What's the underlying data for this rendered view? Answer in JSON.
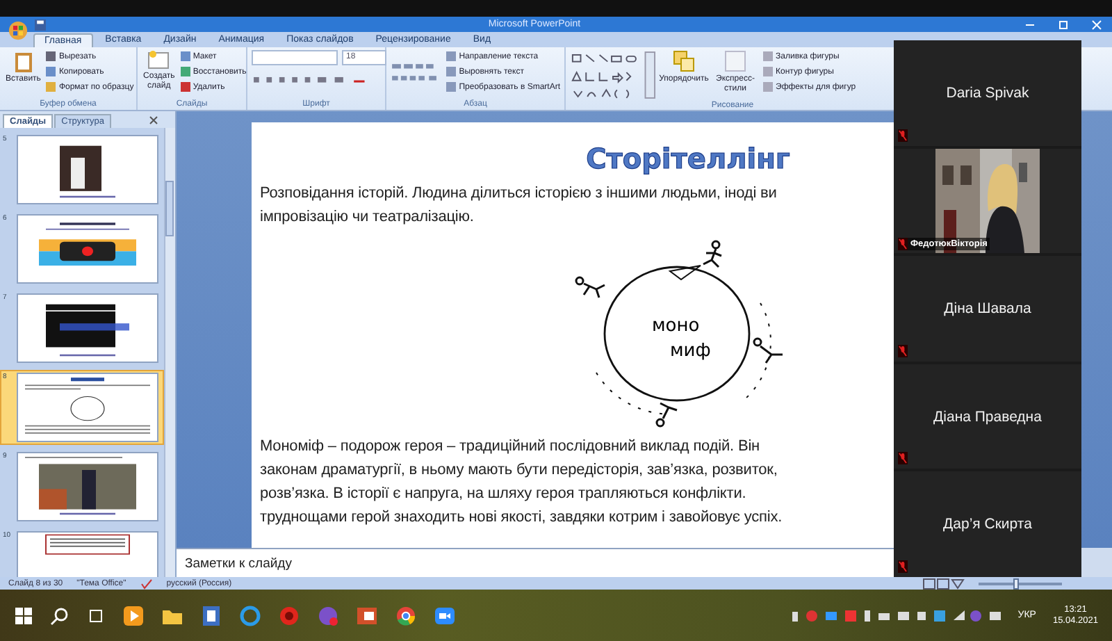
{
  "window": {
    "title": "Microsoft PowerPoint"
  },
  "ribbon_tabs": [
    {
      "label": "Главная",
      "selected": true
    },
    {
      "label": "Вставка",
      "selected": false
    },
    {
      "label": "Дизайн",
      "selected": false
    },
    {
      "label": "Анимация",
      "selected": false
    },
    {
      "label": "Показ слайдов",
      "selected": false
    },
    {
      "label": "Рецензирование",
      "selected": false
    },
    {
      "label": "Вид",
      "selected": false
    }
  ],
  "ribbon": {
    "clipboard": {
      "title": "Буфер обмена",
      "paste": "Вставить",
      "items": [
        "Вырезать",
        "Копировать",
        "Формат по образцу"
      ]
    },
    "slides": {
      "title": "Слайды",
      "create": "Создать слайд",
      "items": [
        "Макет",
        "Восстановить",
        "Удалить"
      ]
    },
    "font": {
      "title": "Шрифт",
      "size": "18"
    },
    "paragraph": {
      "title": "Абзац",
      "items": [
        "Направление текста",
        "Выровнять текст",
        "Преобразовать в SmartArt"
      ]
    },
    "drawing": {
      "title": "Рисование",
      "arrange": "Упорядочить",
      "styles": "Экспресс-стили",
      "items": [
        "Заливка фигуры",
        "Контур фигуры",
        "Эффекты для фигур"
      ]
    }
  },
  "panel_tabs": [
    {
      "label": "Слайды",
      "selected": true
    },
    {
      "label": "Структура",
      "selected": false
    }
  ],
  "thumbnails": [
    {
      "number": "5",
      "selected": false
    },
    {
      "number": "6",
      "kind": "video",
      "selected": false
    },
    {
      "number": "7",
      "kind": "clapper",
      "selected": false
    },
    {
      "number": "8",
      "kind": "diagram",
      "selected": true
    },
    {
      "number": "9",
      "kind": "painting",
      "selected": false
    },
    {
      "number": "10",
      "kind": "text",
      "selected": false
    }
  ],
  "slide": {
    "title": "Сторітеллінг",
    "intro_lines": [
      "Розповідання історій. Людина ділиться історією з іншими людьми, іноді ви",
      "імпровізацію чи театралізацію."
    ],
    "diagram_labels": [
      "моно",
      "миф"
    ],
    "body_lines": [
      "Мономіф – подорож героя – традиційний послідовний виклад подій. Він",
      "законам драматургії, в ньому мають бути передісторія, зав’язка, розвиток,",
      "розв’язка. В історії є напруга, на шляху героя трапляються конфлікти.",
      "труднощами герой знаходить нові якості, завдяки котрим і завойовує успіх."
    ]
  },
  "notes": {
    "placeholder": "Заметки к слайду"
  },
  "status_bar": {
    "slide": "Слайд 8 из 30",
    "theme": "\"Тема Office\"",
    "language": "русский (Россия)",
    "zoom_slider": {
      "level": 0.45
    }
  },
  "participants": [
    {
      "name": "Daria Spivak",
      "kind": "name",
      "muted": true
    },
    {
      "name": "ФедотюкВікторія",
      "kind": "video",
      "muted": true
    },
    {
      "name": "Діна Шавала",
      "kind": "name",
      "muted": true
    },
    {
      "name": "Діана Праведна",
      "kind": "name",
      "muted": true
    },
    {
      "name": "Дар’я Скирта",
      "kind": "name",
      "muted": true
    }
  ],
  "taskbar": {
    "language": "УКР",
    "time": "13:21",
    "date": "15.04.2021"
  }
}
